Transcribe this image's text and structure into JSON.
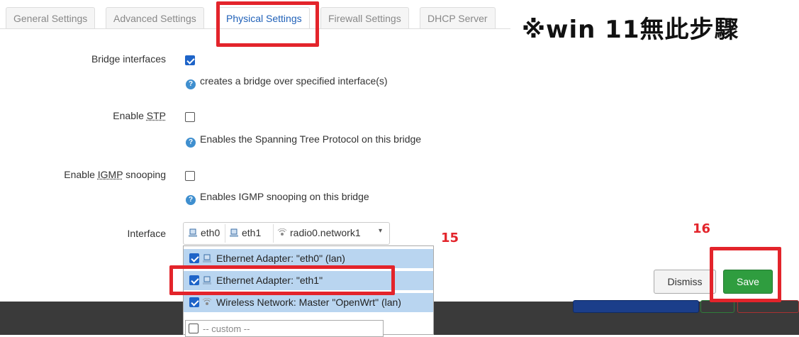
{
  "tabs": [
    {
      "label": "General Settings",
      "active": false
    },
    {
      "label": "Advanced Settings",
      "active": false
    },
    {
      "label": "Physical Settings",
      "active": true
    },
    {
      "label": "Firewall Settings",
      "active": false
    },
    {
      "label": "DHCP Server",
      "active": false
    }
  ],
  "watermark": "※win 11無此步驟",
  "fields": {
    "bridge": {
      "label": "Bridge interfaces",
      "checked": true,
      "help": "creates a bridge over specified interface(s)"
    },
    "stp": {
      "label_pre": "Enable ",
      "label_abbr": "STP",
      "label_post": "",
      "checked": false,
      "help": "Enables the Spanning Tree Protocol on this bridge"
    },
    "igmp": {
      "label_pre": "Enable ",
      "label_abbr": "IGMP",
      "label_post": " snooping",
      "checked": false,
      "help": "Enables IGMP snooping on this bridge"
    },
    "interface": {
      "label": "Interface"
    }
  },
  "interface_select": {
    "chips": [
      {
        "label": "eth0",
        "icon": "ethernet-icon"
      },
      {
        "label": "eth1",
        "icon": "ethernet-icon"
      },
      {
        "label": "radio0.network1",
        "icon": "wireless-icon"
      }
    ],
    "caret": "▾",
    "options": [
      {
        "label": "Ethernet Adapter: \"eth0\" (lan)",
        "checked": true,
        "icon": "ethernet-icon"
      },
      {
        "label": "Ethernet Adapter: \"eth1\"",
        "checked": true,
        "icon": "ethernet-icon"
      },
      {
        "label": "Wireless Network: Master \"OpenWrt\" (lan)",
        "checked": true,
        "icon": "wireless-icon"
      }
    ],
    "custom_placeholder": "-- custom --"
  },
  "buttons": {
    "dismiss": "Dismiss",
    "save": "Save"
  },
  "steps": {
    "step15": "15",
    "step16": "16"
  },
  "colors": {
    "accent": "#2061b8",
    "highlight": "#e3242b",
    "save": "#2f9d3f",
    "option_bg": "#b9d5f0"
  }
}
